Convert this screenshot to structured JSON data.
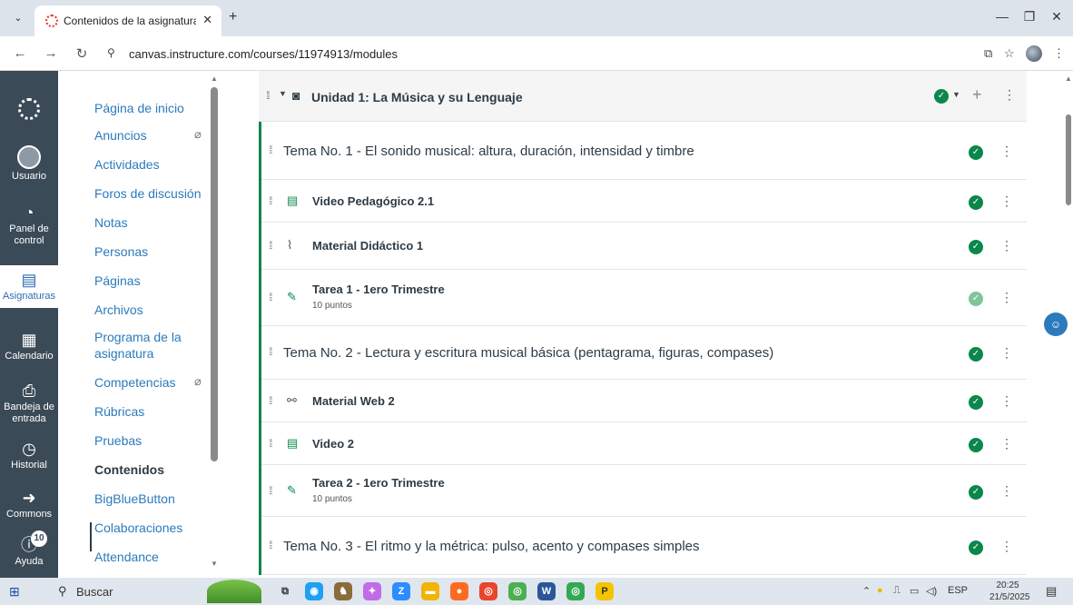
{
  "browser": {
    "tab_title": "Contenidos de la asignatura: ED",
    "url": "canvas.instructure.com/courses/11974913/modules"
  },
  "global_nav": {
    "items": [
      {
        "label": "Usuario"
      },
      {
        "label": "Panel de control"
      },
      {
        "label": "Asignaturas"
      },
      {
        "label": "Calendario"
      },
      {
        "label": "Bandeja de entrada"
      },
      {
        "label": "Historial"
      },
      {
        "label": "Commons"
      },
      {
        "label": "Ayuda",
        "badge": "10"
      }
    ]
  },
  "course_nav": {
    "items": [
      {
        "label": "Página de inicio"
      },
      {
        "label": "Anuncios"
      },
      {
        "label": "Actividades"
      },
      {
        "label": "Foros de discusión"
      },
      {
        "label": "Notas"
      },
      {
        "label": "Personas"
      },
      {
        "label": "Páginas"
      },
      {
        "label": "Archivos"
      },
      {
        "label": "Programa de la asignatura"
      },
      {
        "label": "Competencias"
      },
      {
        "label": "Rúbricas"
      },
      {
        "label": "Pruebas"
      },
      {
        "label": "Contenidos"
      },
      {
        "label": "BigBlueButton"
      },
      {
        "label": "Colaboraciones"
      },
      {
        "label": "Attendance"
      }
    ]
  },
  "module": {
    "title": "Unidad 1: La Música y su Lenguaje",
    "items": [
      {
        "kind": "header",
        "title": "Tema No. 1 - El sonido musical: altura, duración, intensidad y timbre"
      },
      {
        "kind": "page",
        "title": "Video Pedagógico 2.1"
      },
      {
        "kind": "file",
        "title": "Material Didáctico 1"
      },
      {
        "kind": "assignment",
        "title": "Tarea 1 - 1ero Trimestre",
        "sub": "10 puntos"
      },
      {
        "kind": "header",
        "title": "Tema No. 2 - Lectura y escritura musical básica (pentagrama, figuras, compases)"
      },
      {
        "kind": "link",
        "title": "Material Web 2"
      },
      {
        "kind": "page",
        "title": "Video 2"
      },
      {
        "kind": "assignment",
        "title": "Tarea 2 - 1ero Trimestre",
        "sub": "10 puntos"
      },
      {
        "kind": "header",
        "title": "Tema No. 3 - El ritmo y la métrica: pulso, acento y compases simples"
      }
    ]
  },
  "taskbar": {
    "search": "Buscar",
    "lang": "ESP",
    "time": "20:25",
    "date": "21/5/2025"
  }
}
